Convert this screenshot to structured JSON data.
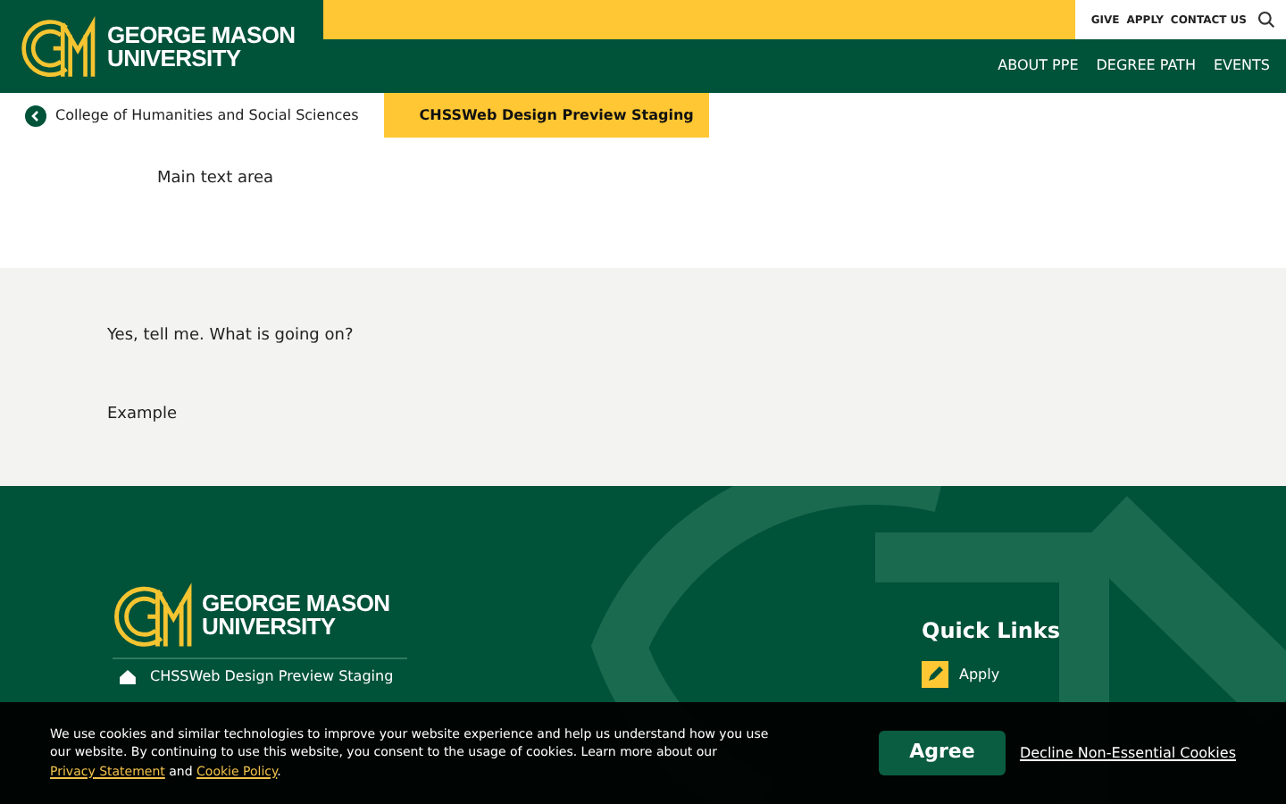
{
  "header": {
    "logo": {
      "line_1": "GEORGE MASON",
      "line_2": "UNIVERSITY"
    },
    "utility_links": [
      "GIVE",
      "APPLY",
      "CONTACT US"
    ],
    "nav": [
      "ABOUT PPE",
      "DEGREE PATH",
      "EVENTS"
    ]
  },
  "breadcrumb": [
    {
      "label": "College of Humanities and Social Sciences",
      "kind": "back"
    },
    {
      "label": "CHSSWeb Design Preview Staging",
      "kind": "home"
    }
  ],
  "main": {
    "text": "Main text area"
  },
  "gray_section": {
    "paragraphs": [
      "Yes, tell me. What is going on?",
      "Example"
    ]
  },
  "footer": {
    "logo": {
      "line_1": "GEORGE MASON",
      "line_2": "UNIVERSITY"
    },
    "site_name": "CHSSWeb Design Preview Staging",
    "quick_links": {
      "title": "Quick Links",
      "items": [
        "Apply"
      ]
    }
  },
  "cookie_banner": {
    "text_before": "We use cookies and similar technologies to improve your website experience and help us understand how you use our website. By continuing to use this website, you consent to the usage of cookies. Learn more about our ",
    "privacy_link": "Privacy Statement",
    "text_middle": " and ",
    "cookie_link": "Cookie Policy",
    "text_after": ".",
    "agree": "Agree",
    "decline": "Decline Non-Essential Cookies"
  }
}
